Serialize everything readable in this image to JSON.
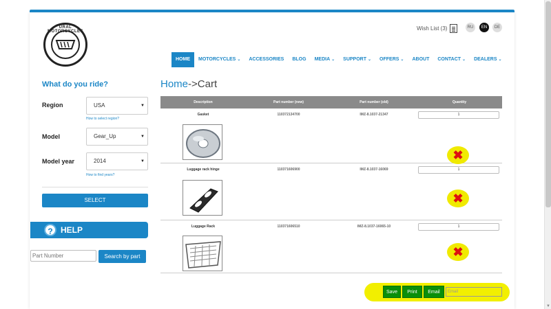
{
  "header": {
    "logo_text": "URAL MOTORCYCLES",
    "wishlist_label": "Wish List (3)",
    "languages": [
      {
        "code": "RU",
        "active": false
      },
      {
        "code": "EN",
        "active": true
      },
      {
        "code": "DE",
        "active": false
      }
    ]
  },
  "nav": {
    "items": [
      {
        "label": "HOME",
        "caret": "",
        "active": true
      },
      {
        "label": "MOTORCYCLES",
        "caret": "⌄",
        "active": false
      },
      {
        "label": "ACCESSORIES",
        "caret": "",
        "active": false
      },
      {
        "label": "BLOG",
        "caret": "",
        "active": false
      },
      {
        "label": "MEDIA",
        "caret": "⌄",
        "active": false
      },
      {
        "label": "SUPPORT",
        "caret": "⌄",
        "active": false
      },
      {
        "label": "OFFERS",
        "caret": "⌄",
        "active": false
      },
      {
        "label": "ABOUT",
        "caret": "",
        "active": false
      },
      {
        "label": "CONTACT",
        "caret": "⌄",
        "active": false
      },
      {
        "label": "DEALERS",
        "caret": "⌄",
        "active": false
      }
    ]
  },
  "sidebar": {
    "title": "What do you ride?",
    "region_label": "Region",
    "region_value": "USA",
    "region_help": "How to select region?",
    "model_label": "Model",
    "model_value": "Gear_Up",
    "year_label": "Model year",
    "year_value": "2014",
    "year_help": "How to find years?",
    "select_button": "SELECT",
    "help_label": "HELP",
    "part_placeholder": "Part Number",
    "search_button": "Search by part"
  },
  "main": {
    "breadcrumb_home": "Home",
    "breadcrumb_rest": "->Cart",
    "columns": [
      "Description",
      "Part number (new)",
      "Part number (old)",
      "Quantity"
    ],
    "rows": [
      {
        "name": "Gasket",
        "part_new": "110372134700",
        "part_old": "IMZ-8.1037-21347",
        "qty": "1",
        "image": "gasket"
      },
      {
        "name": "Luggage rack hinge",
        "part_new": "110371606900",
        "part_old": "IMZ-8.1037-16069",
        "qty": "1",
        "image": "hinge"
      },
      {
        "name": "Luggage Rack",
        "part_new": "110371606510",
        "part_old": "IMZ-8.1037-16065-10",
        "qty": "1",
        "image": "rack"
      }
    ],
    "remove_icon": "✖",
    "save_button": "Save",
    "print_button": "Print",
    "email_button": "Email",
    "email_placeholder": "Email",
    "highlight_color": "#f2ef00",
    "accent_color": "#1b86c6",
    "action_color": "#0a8f0a"
  }
}
